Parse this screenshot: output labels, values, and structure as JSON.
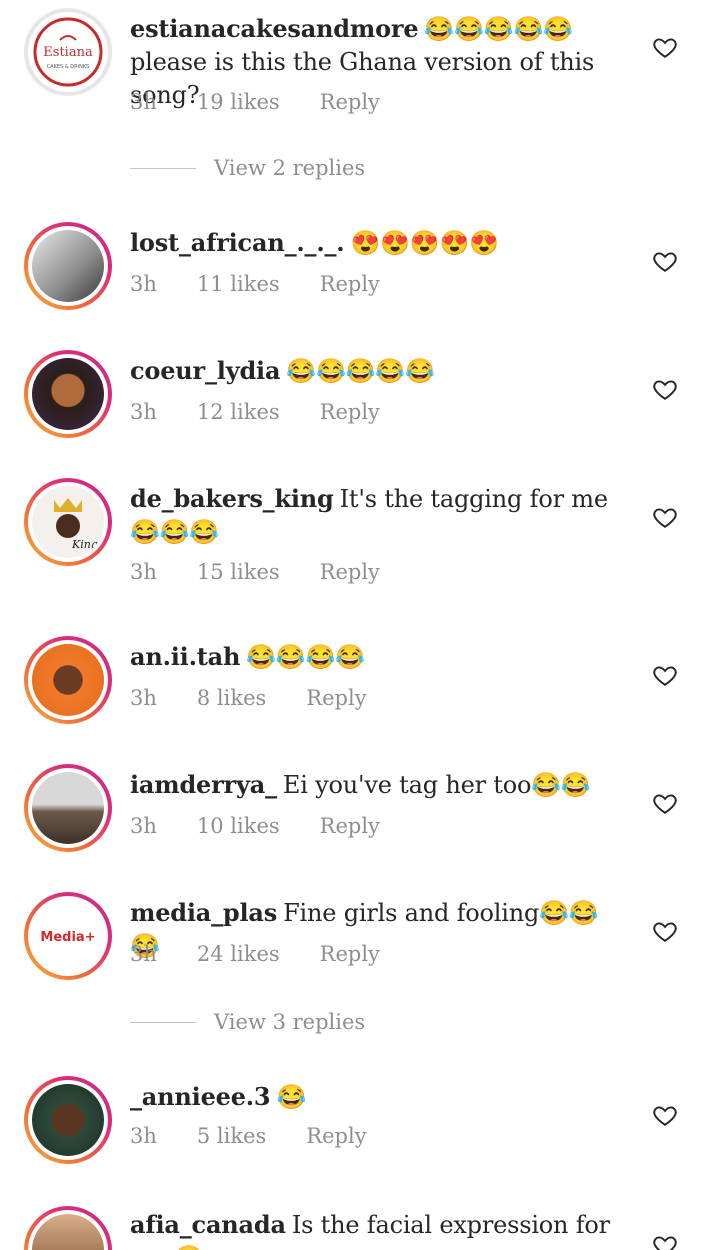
{
  "comments": [
    {
      "user": "estianacakesandmore",
      "text": "😂😂😂😂😂 please is this the Ghana version of this song?",
      "time": "3h",
      "likes": "19 likes",
      "reply": "Reply"
    },
    {
      "user": "lost_african_._._.",
      "text": "😍😍😍😍😍",
      "time": "3h",
      "likes": "11 likes",
      "reply": "Reply"
    },
    {
      "user": "coeur_lydia",
      "text": "😂😂😂😂😂",
      "time": "3h",
      "likes": "12 likes",
      "reply": "Reply"
    },
    {
      "user": "de_bakers_king",
      "text": "It's the tagging for me 😂😂😂",
      "time": "3h",
      "likes": "15 likes",
      "reply": "Reply"
    },
    {
      "user": "an.ii.tah",
      "text": "😂😂😂😂",
      "time": "3h",
      "likes": "8 likes",
      "reply": "Reply"
    },
    {
      "user": "iamderrya_",
      "text": "Ei you've tag her too😂😂",
      "time": "3h",
      "likes": "10 likes",
      "reply": "Reply"
    },
    {
      "user": "media_plas",
      "text": "Fine girls and fooling😂😂😂",
      "time": "3h",
      "likes": "24 likes",
      "reply": "Reply"
    },
    {
      "user": "_annieee.3",
      "text": "😂",
      "time": "3h",
      "likes": "5 likes",
      "reply": "Reply"
    },
    {
      "user": "afia_canada",
      "text": "Is the facial expression for me 😂",
      "time": "",
      "likes": "",
      "reply": ""
    }
  ],
  "view_replies": [
    {
      "label": "View 2 replies"
    },
    {
      "label": "View 3 replies"
    }
  ],
  "avatars": {
    "estiana_logo_text": "Estiana",
    "estiana_logo_sub": "CAKES & DRINKS",
    "media_logo_text": "Media+",
    "kings_logo_text": "King"
  },
  "icons": {
    "like": "heart-outline-icon"
  },
  "colors": {
    "text": "#262626",
    "muted": "#8e8e8e",
    "ring_start": "#f9b43a",
    "ring_end": "#c13584"
  }
}
